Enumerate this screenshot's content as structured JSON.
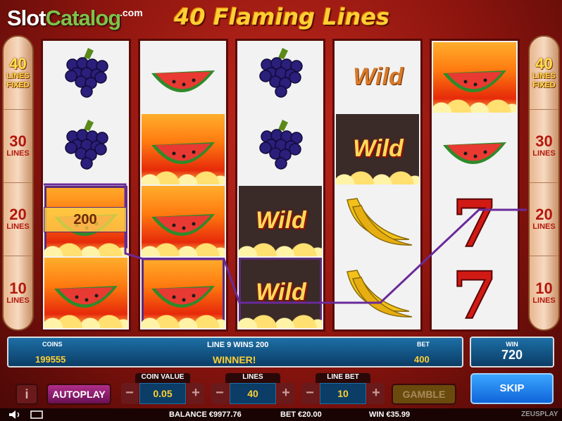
{
  "brand": {
    "name_part1": "Slot",
    "name_part2": "Catalog",
    "domain": ".com"
  },
  "game_title": "40 Flaming Lines",
  "side_panels": [
    {
      "value": "40",
      "line1": "LINES",
      "line2": "FIXED"
    },
    {
      "value": "30",
      "line1": "LINES"
    },
    {
      "value": "20",
      "line1": "LINES"
    },
    {
      "value": "10",
      "line1": "LINES"
    }
  ],
  "reels": [
    [
      "grapes",
      "grapes",
      "watermelon-fire",
      "watermelon-fire"
    ],
    [
      "watermelon",
      "watermelon-fire",
      "watermelon-fire",
      "watermelon-fire"
    ],
    [
      "grapes",
      "grapes",
      "wild-fire",
      "wild-fire"
    ],
    [
      "wild",
      "wild-fire",
      "banana",
      "banana"
    ],
    [
      "watermelon-fire",
      "watermelon",
      "seven",
      "seven"
    ]
  ],
  "wild_label": "Wild",
  "win_amount_on_reel": "200",
  "info": {
    "coins_label": "COINS",
    "coins_value": "199555",
    "line_win_text": "LINE 9 WINS 200",
    "status": "WINNER!",
    "bet_label": "BET",
    "bet_value": "400"
  },
  "win_box": {
    "label": "WIN",
    "value": "720"
  },
  "controls": {
    "info_label": "i",
    "autoplay_label": "AUTOPLAY",
    "coin_value": {
      "caption": "COIN VALUE",
      "value": "0.05"
    },
    "lines": {
      "caption": "LINES",
      "value": "40"
    },
    "line_bet": {
      "caption": "LINE BET",
      "value": "10"
    },
    "gamble_label": "GAMBLE",
    "skip_label": "SKIP",
    "minus": "−",
    "plus": "+"
  },
  "footer": {
    "balance": "BALANCE €9977.76",
    "bet": "BET €20.00",
    "win": "WIN €35.99",
    "provider": "ZEUSPLAY"
  },
  "colors": {
    "accent": "#ffcf33",
    "panel_blue": "#1d6fa6",
    "skip_blue": "#1064d9",
    "autoplay_purple": "#b02e8a"
  }
}
